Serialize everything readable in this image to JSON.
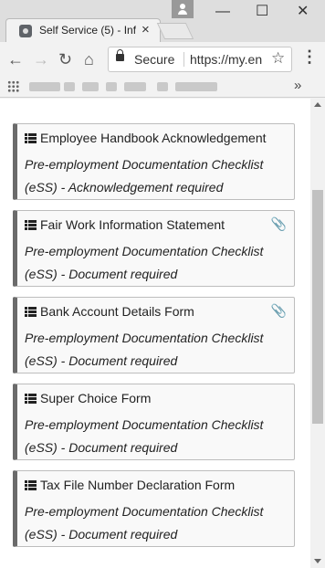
{
  "browser": {
    "tab_title": "Self Service (5) - Inf",
    "tab_close": "×",
    "window_buttons": {
      "minimize": "—",
      "maximize": "☐",
      "close": "✕"
    },
    "toolbar": {
      "back": "←",
      "forward": "→",
      "reload": "↻",
      "home": "⌂",
      "star": "☆",
      "menu": "⋮"
    },
    "address": {
      "secure_label": "Secure",
      "url": "https://my.en"
    },
    "bookmarks_more": "»"
  },
  "cards": [
    {
      "title": "Employee Handbook Acknowledgement",
      "subtitle": "Pre-employment Documentation Checklist (eSS) - Acknowledgement required",
      "attachment": false
    },
    {
      "title": "Fair Work Information Statement",
      "subtitle": "Pre-employment Documentation Checklist (eSS) - Document required",
      "attachment": true
    },
    {
      "title": "Bank Account Details Form",
      "subtitle": "Pre-employment Documentation Checklist (eSS) - Document required",
      "attachment": true
    },
    {
      "title": "Super Choice Form",
      "subtitle": "Pre-employment Documentation Checklist (eSS) - Document required",
      "attachment": false
    },
    {
      "title": "Tax File Number Declaration Form",
      "subtitle": "Pre-employment Documentation Checklist (eSS) - Document required",
      "attachment": false
    }
  ],
  "icons": {
    "card_icon": "list-icon",
    "attachment_icon": "paperclip-icon",
    "attachment_glyph": "📎"
  }
}
